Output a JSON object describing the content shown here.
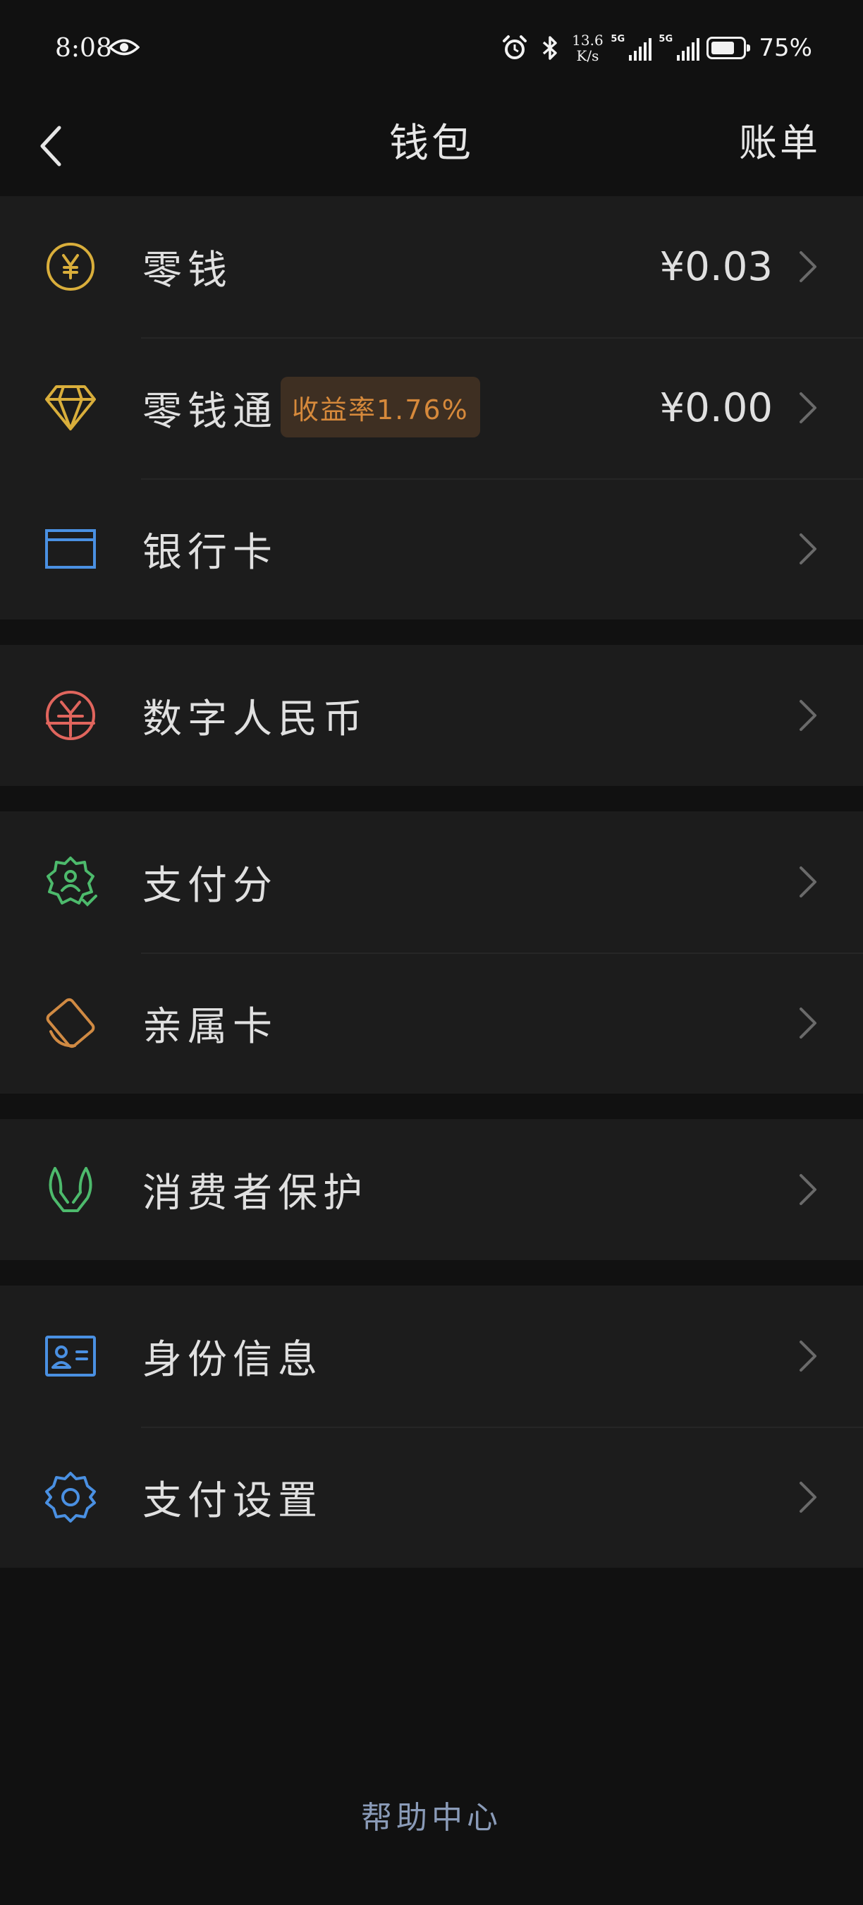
{
  "status_bar": {
    "time": "8:08",
    "net_speed_value": "13.6",
    "net_speed_unit": "K/s",
    "network_1": "5G",
    "network_2": "5G",
    "battery_percent": "75%",
    "battery_level": 0.75
  },
  "header": {
    "title": "钱包",
    "bill_label": "账单"
  },
  "groups": [
    {
      "items": [
        {
          "label": "零钱",
          "value": "¥0.03",
          "icon": "yen-coin-icon",
          "color": "#d9ae3b"
        },
        {
          "label": "零钱通",
          "value": "¥0.00",
          "badge": "收益率1.76%",
          "icon": "diamond-icon",
          "color": "#d9ae3b"
        },
        {
          "label": "银行卡",
          "icon": "bank-card-icon",
          "color": "#4a90e2"
        }
      ]
    },
    {
      "items": [
        {
          "label": "数字人民币",
          "icon": "digital-rmb-icon",
          "color": "#e0655d"
        }
      ]
    },
    {
      "items": [
        {
          "label": "支付分",
          "icon": "pay-score-badge-icon",
          "color": "#4dba6c"
        },
        {
          "label": "亲属卡",
          "icon": "family-card-icon",
          "color": "#d08a43"
        }
      ]
    },
    {
      "items": [
        {
          "label": "消费者保护",
          "icon": "protection-hands-icon",
          "color": "#4dba6c"
        }
      ]
    },
    {
      "items": [
        {
          "label": "身份信息",
          "icon": "id-card-icon",
          "color": "#4a90e2"
        },
        {
          "label": "支付设置",
          "icon": "gear-icon",
          "color": "#4a90e2"
        }
      ]
    }
  ],
  "footer": {
    "help_label": "帮助中心"
  }
}
